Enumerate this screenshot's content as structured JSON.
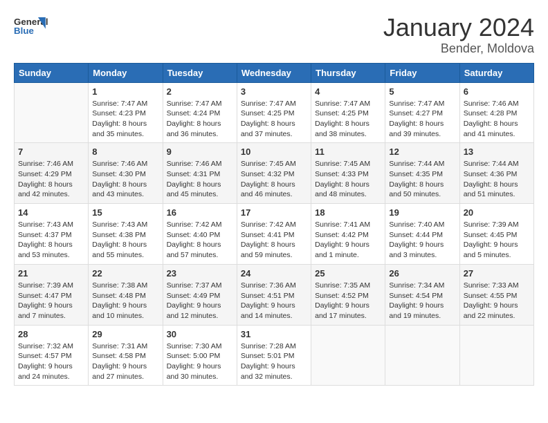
{
  "header": {
    "logo_line1": "General",
    "logo_line2": "Blue",
    "title": "January 2024",
    "subtitle": "Bender, Moldova"
  },
  "weekdays": [
    "Sunday",
    "Monday",
    "Tuesday",
    "Wednesday",
    "Thursday",
    "Friday",
    "Saturday"
  ],
  "weeks": [
    [
      {
        "day": "",
        "content": ""
      },
      {
        "day": "1",
        "content": "Sunrise: 7:47 AM\nSunset: 4:23 PM\nDaylight: 8 hours\nand 35 minutes."
      },
      {
        "day": "2",
        "content": "Sunrise: 7:47 AM\nSunset: 4:24 PM\nDaylight: 8 hours\nand 36 minutes."
      },
      {
        "day": "3",
        "content": "Sunrise: 7:47 AM\nSunset: 4:25 PM\nDaylight: 8 hours\nand 37 minutes."
      },
      {
        "day": "4",
        "content": "Sunrise: 7:47 AM\nSunset: 4:25 PM\nDaylight: 8 hours\nand 38 minutes."
      },
      {
        "day": "5",
        "content": "Sunrise: 7:47 AM\nSunset: 4:27 PM\nDaylight: 8 hours\nand 39 minutes."
      },
      {
        "day": "6",
        "content": "Sunrise: 7:46 AM\nSunset: 4:28 PM\nDaylight: 8 hours\nand 41 minutes."
      }
    ],
    [
      {
        "day": "7",
        "content": "Sunrise: 7:46 AM\nSunset: 4:29 PM\nDaylight: 8 hours\nand 42 minutes."
      },
      {
        "day": "8",
        "content": "Sunrise: 7:46 AM\nSunset: 4:30 PM\nDaylight: 8 hours\nand 43 minutes."
      },
      {
        "day": "9",
        "content": "Sunrise: 7:46 AM\nSunset: 4:31 PM\nDaylight: 8 hours\nand 45 minutes."
      },
      {
        "day": "10",
        "content": "Sunrise: 7:45 AM\nSunset: 4:32 PM\nDaylight: 8 hours\nand 46 minutes."
      },
      {
        "day": "11",
        "content": "Sunrise: 7:45 AM\nSunset: 4:33 PM\nDaylight: 8 hours\nand 48 minutes."
      },
      {
        "day": "12",
        "content": "Sunrise: 7:44 AM\nSunset: 4:35 PM\nDaylight: 8 hours\nand 50 minutes."
      },
      {
        "day": "13",
        "content": "Sunrise: 7:44 AM\nSunset: 4:36 PM\nDaylight: 8 hours\nand 51 minutes."
      }
    ],
    [
      {
        "day": "14",
        "content": "Sunrise: 7:43 AM\nSunset: 4:37 PM\nDaylight: 8 hours\nand 53 minutes."
      },
      {
        "day": "15",
        "content": "Sunrise: 7:43 AM\nSunset: 4:38 PM\nDaylight: 8 hours\nand 55 minutes."
      },
      {
        "day": "16",
        "content": "Sunrise: 7:42 AM\nSunset: 4:40 PM\nDaylight: 8 hours\nand 57 minutes."
      },
      {
        "day": "17",
        "content": "Sunrise: 7:42 AM\nSunset: 4:41 PM\nDaylight: 8 hours\nand 59 minutes."
      },
      {
        "day": "18",
        "content": "Sunrise: 7:41 AM\nSunset: 4:42 PM\nDaylight: 9 hours\nand 1 minute."
      },
      {
        "day": "19",
        "content": "Sunrise: 7:40 AM\nSunset: 4:44 PM\nDaylight: 9 hours\nand 3 minutes."
      },
      {
        "day": "20",
        "content": "Sunrise: 7:39 AM\nSunset: 4:45 PM\nDaylight: 9 hours\nand 5 minutes."
      }
    ],
    [
      {
        "day": "21",
        "content": "Sunrise: 7:39 AM\nSunset: 4:47 PM\nDaylight: 9 hours\nand 7 minutes."
      },
      {
        "day": "22",
        "content": "Sunrise: 7:38 AM\nSunset: 4:48 PM\nDaylight: 9 hours\nand 10 minutes."
      },
      {
        "day": "23",
        "content": "Sunrise: 7:37 AM\nSunset: 4:49 PM\nDaylight: 9 hours\nand 12 minutes."
      },
      {
        "day": "24",
        "content": "Sunrise: 7:36 AM\nSunset: 4:51 PM\nDaylight: 9 hours\nand 14 minutes."
      },
      {
        "day": "25",
        "content": "Sunrise: 7:35 AM\nSunset: 4:52 PM\nDaylight: 9 hours\nand 17 minutes."
      },
      {
        "day": "26",
        "content": "Sunrise: 7:34 AM\nSunset: 4:54 PM\nDaylight: 9 hours\nand 19 minutes."
      },
      {
        "day": "27",
        "content": "Sunrise: 7:33 AM\nSunset: 4:55 PM\nDaylight: 9 hours\nand 22 minutes."
      }
    ],
    [
      {
        "day": "28",
        "content": "Sunrise: 7:32 AM\nSunset: 4:57 PM\nDaylight: 9 hours\nand 24 minutes."
      },
      {
        "day": "29",
        "content": "Sunrise: 7:31 AM\nSunset: 4:58 PM\nDaylight: 9 hours\nand 27 minutes."
      },
      {
        "day": "30",
        "content": "Sunrise: 7:30 AM\nSunset: 5:00 PM\nDaylight: 9 hours\nand 30 minutes."
      },
      {
        "day": "31",
        "content": "Sunrise: 7:28 AM\nSunset: 5:01 PM\nDaylight: 9 hours\nand 32 minutes."
      },
      {
        "day": "",
        "content": ""
      },
      {
        "day": "",
        "content": ""
      },
      {
        "day": "",
        "content": ""
      }
    ]
  ]
}
